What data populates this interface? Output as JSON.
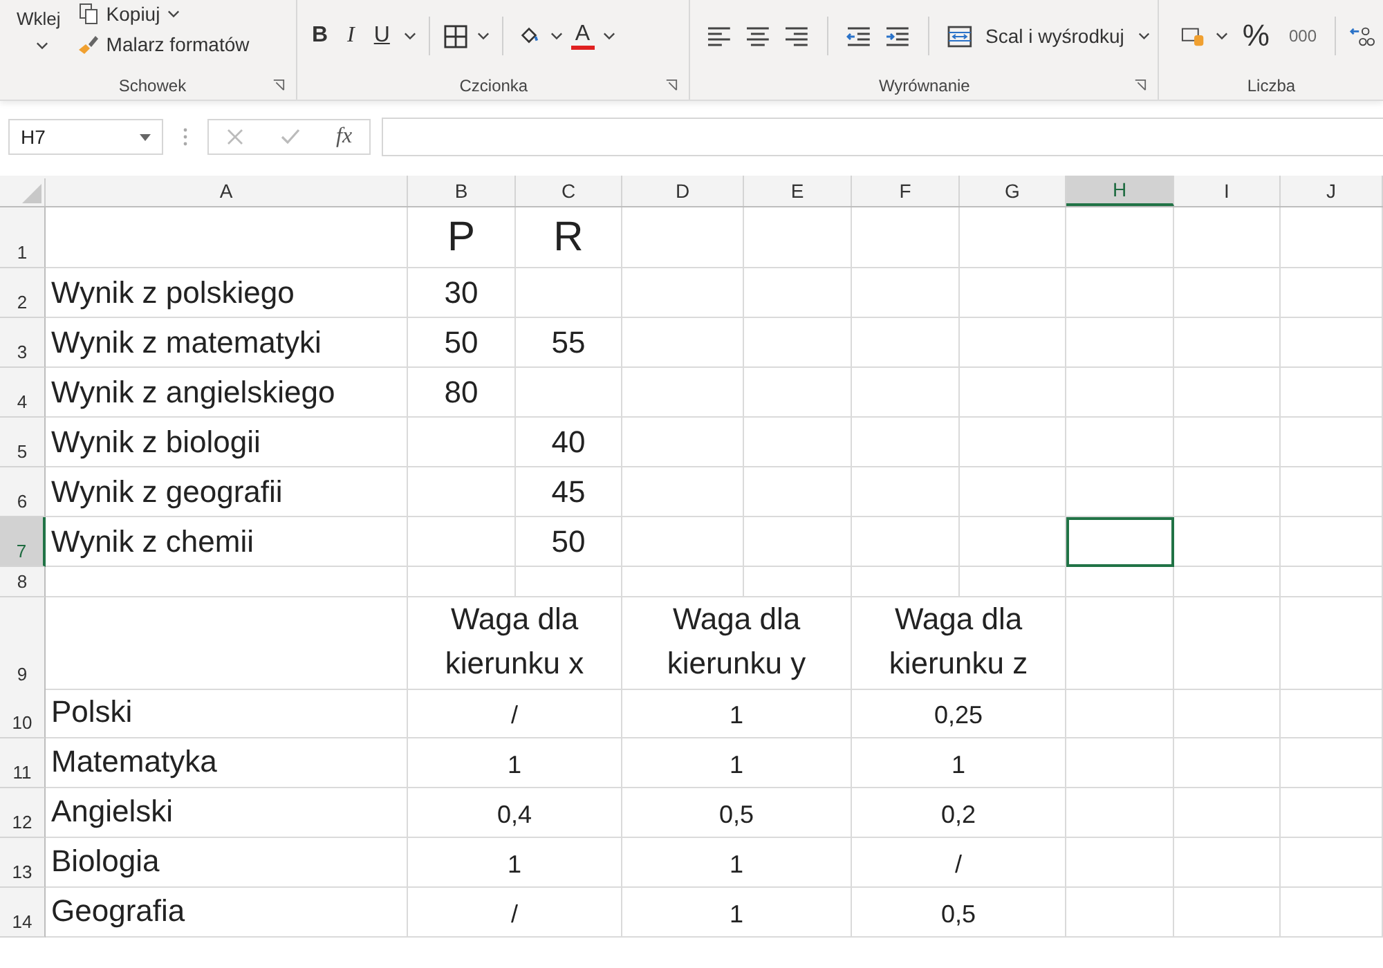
{
  "ribbon": {
    "groups": [
      {
        "kind": "clipboard",
        "label": "Schowek",
        "paste": "Wklej",
        "copy": "Kopiuj",
        "painter": "Malarz formatów"
      },
      {
        "kind": "font",
        "label": "Czcionka",
        "bold": "B",
        "italic": "I",
        "underline": "U",
        "font_color": "A"
      },
      {
        "kind": "alignment",
        "label": "Wyrównanie",
        "merge": "Scal i wyśrodkuj"
      },
      {
        "kind": "number",
        "label": "Liczba",
        "percent": "%",
        "thousands": "000"
      }
    ]
  },
  "formula_bar": {
    "name_box": "H7",
    "function_label": "fx"
  },
  "columns": [
    {
      "label": "A",
      "selected": false
    },
    {
      "label": "B",
      "selected": false
    },
    {
      "label": "C",
      "selected": false
    },
    {
      "label": "D",
      "selected": false
    },
    {
      "label": "E",
      "selected": false
    },
    {
      "label": "F",
      "selected": false
    },
    {
      "label": "G",
      "selected": false
    },
    {
      "label": "H",
      "selected": true
    },
    {
      "label": "I",
      "selected": false
    },
    {
      "label": "J",
      "selected": false
    }
  ],
  "rows": [
    {
      "number": "1",
      "kind": "heading",
      "selected": false,
      "cells": [
        {
          "kind": "blank"
        },
        {
          "kind": "text",
          "text": "P"
        },
        {
          "kind": "text",
          "text": "R"
        },
        {
          "kind": "blank"
        },
        {
          "kind": "blank"
        },
        {
          "kind": "blank"
        },
        {
          "kind": "blank"
        },
        {
          "kind": "blank"
        },
        {
          "kind": "blank"
        },
        {
          "kind": "blank"
        }
      ]
    },
    {
      "number": "2",
      "kind": "score",
      "selected": false,
      "cells": [
        {
          "kind": "text",
          "text": "Wynik z polskiego"
        },
        {
          "kind": "text",
          "text": "30"
        },
        {
          "kind": "blank"
        },
        {
          "kind": "blank"
        },
        {
          "kind": "blank"
        },
        {
          "kind": "blank"
        },
        {
          "kind": "blank"
        },
        {
          "kind": "blank"
        },
        {
          "kind": "blank"
        },
        {
          "kind": "blank"
        }
      ]
    },
    {
      "number": "3",
      "kind": "score",
      "selected": false,
      "cells": [
        {
          "kind": "text",
          "text": "Wynik z matematyki"
        },
        {
          "kind": "text",
          "text": "50"
        },
        {
          "kind": "text",
          "text": "55"
        },
        {
          "kind": "blank"
        },
        {
          "kind": "blank"
        },
        {
          "kind": "blank"
        },
        {
          "kind": "blank"
        },
        {
          "kind": "blank"
        },
        {
          "kind": "blank"
        },
        {
          "kind": "blank"
        }
      ]
    },
    {
      "number": "4",
      "kind": "score",
      "selected": false,
      "cells": [
        {
          "kind": "text",
          "text": "Wynik z angielskiego"
        },
        {
          "kind": "text",
          "text": "80"
        },
        {
          "kind": "blank"
        },
        {
          "kind": "blank"
        },
        {
          "kind": "blank"
        },
        {
          "kind": "blank"
        },
        {
          "kind": "blank"
        },
        {
          "kind": "blank"
        },
        {
          "kind": "blank"
        },
        {
          "kind": "blank"
        }
      ]
    },
    {
      "number": "5",
      "kind": "score",
      "selected": false,
      "cells": [
        {
          "kind": "text",
          "text": "Wynik z biologii"
        },
        {
          "kind": "blank"
        },
        {
          "kind": "text",
          "text": "40"
        },
        {
          "kind": "blank"
        },
        {
          "kind": "blank"
        },
        {
          "kind": "blank"
        },
        {
          "kind": "blank"
        },
        {
          "kind": "blank"
        },
        {
          "kind": "blank"
        },
        {
          "kind": "blank"
        }
      ]
    },
    {
      "number": "6",
      "kind": "score",
      "selected": false,
      "cells": [
        {
          "kind": "text",
          "text": "Wynik z geografii"
        },
        {
          "kind": "blank"
        },
        {
          "kind": "text",
          "text": "45"
        },
        {
          "kind": "blank"
        },
        {
          "kind": "blank"
        },
        {
          "kind": "blank"
        },
        {
          "kind": "blank"
        },
        {
          "kind": "blank"
        },
        {
          "kind": "blank"
        },
        {
          "kind": "blank"
        }
      ]
    },
    {
      "number": "7",
      "kind": "score",
      "selected": true,
      "cells": [
        {
          "kind": "text",
          "text": "Wynik z chemii"
        },
        {
          "kind": "blank"
        },
        {
          "kind": "text",
          "text": "50"
        },
        {
          "kind": "blank"
        },
        {
          "kind": "blank"
        },
        {
          "kind": "blank"
        },
        {
          "kind": "blank"
        },
        {
          "kind": "active"
        },
        {
          "kind": "blank"
        },
        {
          "kind": "blank"
        }
      ]
    },
    {
      "number": "8",
      "kind": "spacer",
      "selected": false,
      "cells": [
        {
          "kind": "blank"
        },
        {
          "kind": "blank"
        },
        {
          "kind": "blank"
        },
        {
          "kind": "blank"
        },
        {
          "kind": "blank"
        },
        {
          "kind": "blank"
        },
        {
          "kind": "blank"
        },
        {
          "kind": "blank"
        },
        {
          "kind": "blank"
        },
        {
          "kind": "blank"
        }
      ]
    },
    {
      "number": "9",
      "kind": "weight-header",
      "selected": false,
      "cells": [
        {
          "kind": "blank"
        },
        {
          "kind": "merged",
          "text": "Waga dla kierunku x"
        },
        {
          "kind": "merged",
          "text": "Waga dla kierunku y"
        },
        {
          "kind": "merged",
          "text": "Waga dla kierunku z"
        },
        {
          "kind": "blank"
        },
        {
          "kind": "blank"
        },
        {
          "kind": "blank"
        }
      ]
    },
    {
      "number": "10",
      "kind": "weight",
      "selected": false,
      "cells": [
        {
          "kind": "text",
          "text": "Polski"
        },
        {
          "kind": "merged",
          "text": "/"
        },
        {
          "kind": "merged",
          "text": "1"
        },
        {
          "kind": "merged",
          "text": "0,25"
        },
        {
          "kind": "blank"
        },
        {
          "kind": "blank"
        },
        {
          "kind": "blank"
        }
      ]
    },
    {
      "number": "11",
      "kind": "weight",
      "selected": false,
      "cells": [
        {
          "kind": "text",
          "text": "Matematyka"
        },
        {
          "kind": "merged",
          "text": "1"
        },
        {
          "kind": "merged",
          "text": "1"
        },
        {
          "kind": "merged",
          "text": "1"
        },
        {
          "kind": "blank"
        },
        {
          "kind": "blank"
        },
        {
          "kind": "blank"
        }
      ]
    },
    {
      "number": "12",
      "kind": "weight",
      "selected": false,
      "cells": [
        {
          "kind": "text",
          "text": "Angielski"
        },
        {
          "kind": "merged",
          "text": "0,4"
        },
        {
          "kind": "merged",
          "text": "0,5"
        },
        {
          "kind": "merged",
          "text": "0,2"
        },
        {
          "kind": "blank"
        },
        {
          "kind": "blank"
        },
        {
          "kind": "blank"
        }
      ]
    },
    {
      "number": "13",
      "kind": "weight",
      "selected": false,
      "cells": [
        {
          "kind": "text",
          "text": "Biologia"
        },
        {
          "kind": "merged",
          "text": "1"
        },
        {
          "kind": "merged",
          "text": "1"
        },
        {
          "kind": "merged",
          "text": "/"
        },
        {
          "kind": "blank"
        },
        {
          "kind": "blank"
        },
        {
          "kind": "blank"
        }
      ]
    },
    {
      "number": "14",
      "kind": "weight",
      "selected": false,
      "cells": [
        {
          "kind": "text",
          "text": "Geografia"
        },
        {
          "kind": "merged",
          "text": "/"
        },
        {
          "kind": "merged",
          "text": "1"
        },
        {
          "kind": "merged",
          "text": "0,5"
        },
        {
          "kind": "blank"
        },
        {
          "kind": "blank"
        },
        {
          "kind": "blank"
        }
      ]
    }
  ]
}
